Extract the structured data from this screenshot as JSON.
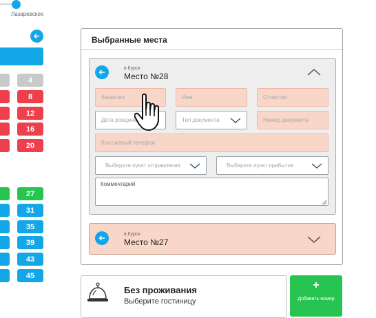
{
  "station": {
    "label": "Лазаревское"
  },
  "seats_left": [
    {
      "label": "4",
      "color": "grey"
    },
    {
      "label": "8",
      "color": "red"
    },
    {
      "label": "12",
      "color": "red"
    },
    {
      "label": "16",
      "color": "red"
    },
    {
      "label": "20",
      "color": "red"
    },
    {
      "label": "27",
      "color": "green"
    },
    {
      "label": "31",
      "color": "blue"
    },
    {
      "label": "35",
      "color": "blue"
    },
    {
      "label": "39",
      "color": "blue"
    },
    {
      "label": "43",
      "color": "blue"
    },
    {
      "label": "45",
      "color": "blue"
    }
  ],
  "panel": {
    "title": "Выбранные места",
    "card1": {
      "direction": "в Курск",
      "seat": "Место №28",
      "fields": {
        "surname": "Фамилия",
        "name": "Имя",
        "patronymic": "Отчество",
        "birthdate": "Дата рождения",
        "doc_type": "Тип документа",
        "doc_number": "Номер документа",
        "phone": "Контактный телефон",
        "departure": "Выберите пункт отправления",
        "arrival": "Выберите пункт прибытия",
        "comment": "Комментарий"
      }
    },
    "card2": {
      "direction": "в Курск",
      "seat": "Место №27"
    }
  },
  "hotel": {
    "title": "Без проживания",
    "subtitle": "Выберите гостиницу"
  },
  "add_button": {
    "plus": "+",
    "label": "Добавить номер"
  },
  "icons": {
    "back": "arrow-left-icon",
    "collapse": "chevron-up-icon",
    "expand": "chevron-down-icon",
    "hotel": "service-bell-icon",
    "cursor": "hand-pointer-icon"
  },
  "colors": {
    "accent_blue": "#14a7e8",
    "seat_red": "#ee3f4c",
    "seat_green": "#28c452",
    "seat_grey": "#c9c9c9",
    "field_pink": "#f9d7c8"
  }
}
